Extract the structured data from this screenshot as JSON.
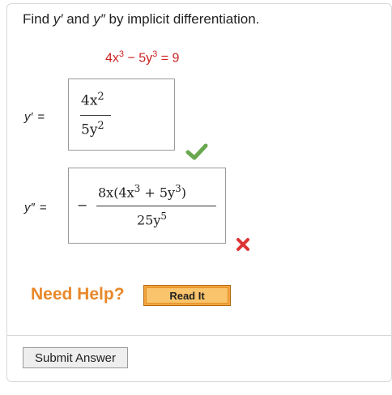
{
  "question": {
    "prefix": "Find ",
    "y1": "y′",
    "mid": " and ",
    "y2": "y″",
    "suffix": " by implicit differentiation."
  },
  "equation": {
    "part1": "4x",
    "exp1": "3",
    "minus": " − ",
    "part2": "5y",
    "exp2": "3",
    "rest": " = 9"
  },
  "answer1": {
    "label": "y′",
    "equals": "=",
    "numerator": "4x",
    "numerator_exp": "2",
    "denominator": "5y",
    "denominator_exp": "2",
    "status_icon": "check-icon",
    "status": "correct"
  },
  "answer2": {
    "label": "y″",
    "equals": "=",
    "sign": "−",
    "numerator_a": "8x(4x",
    "numerator_a_exp": "3",
    "numerator_b": " + 5y",
    "numerator_b_exp": "3",
    "numerator_c": ")",
    "denominator": "25y",
    "denominator_exp": "5",
    "status_icon": "x-icon",
    "status": "incorrect"
  },
  "help": {
    "label": "Need Help?",
    "button": "Read It"
  },
  "submit_label": "Submit Answer",
  "colors": {
    "equation": "#cc2222",
    "check": "#6aa84f",
    "x": "#dd3333",
    "help": "#e8882a",
    "read_it": "#f4a53d"
  }
}
